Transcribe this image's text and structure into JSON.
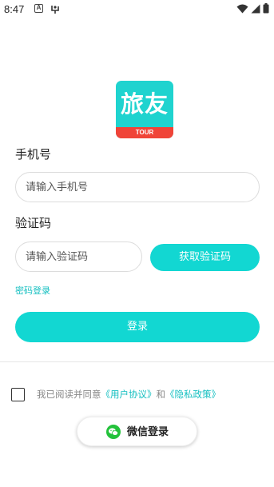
{
  "status_bar": {
    "time": "8:47",
    "icons": [
      "a-notification-icon",
      "usb-debug-icon",
      "wifi-icon",
      "signal-icon",
      "battery-icon"
    ]
  },
  "logo": {
    "title": "旅友",
    "subtitle": "TOUR",
    "colors": {
      "primary": "#1fd3cf",
      "band": "#f04438"
    }
  },
  "form": {
    "phone_label": "手机号",
    "phone_placeholder": "请输入手机号",
    "code_label": "验证码",
    "code_placeholder": "请输入验证码",
    "get_code_button": "获取验证码",
    "password_login_link": "密码登录",
    "login_button": "登录"
  },
  "agreement": {
    "checked": false,
    "prefix": "我已阅读并同意",
    "user_agreement": "《用户协议》",
    "conjunction": "和",
    "privacy_policy": "《隐私政策》"
  },
  "wechat": {
    "button_label": "微信登录",
    "icon": "wechat-icon"
  },
  "colors": {
    "accent": "#12d7d2",
    "link": "#13bfc0"
  }
}
